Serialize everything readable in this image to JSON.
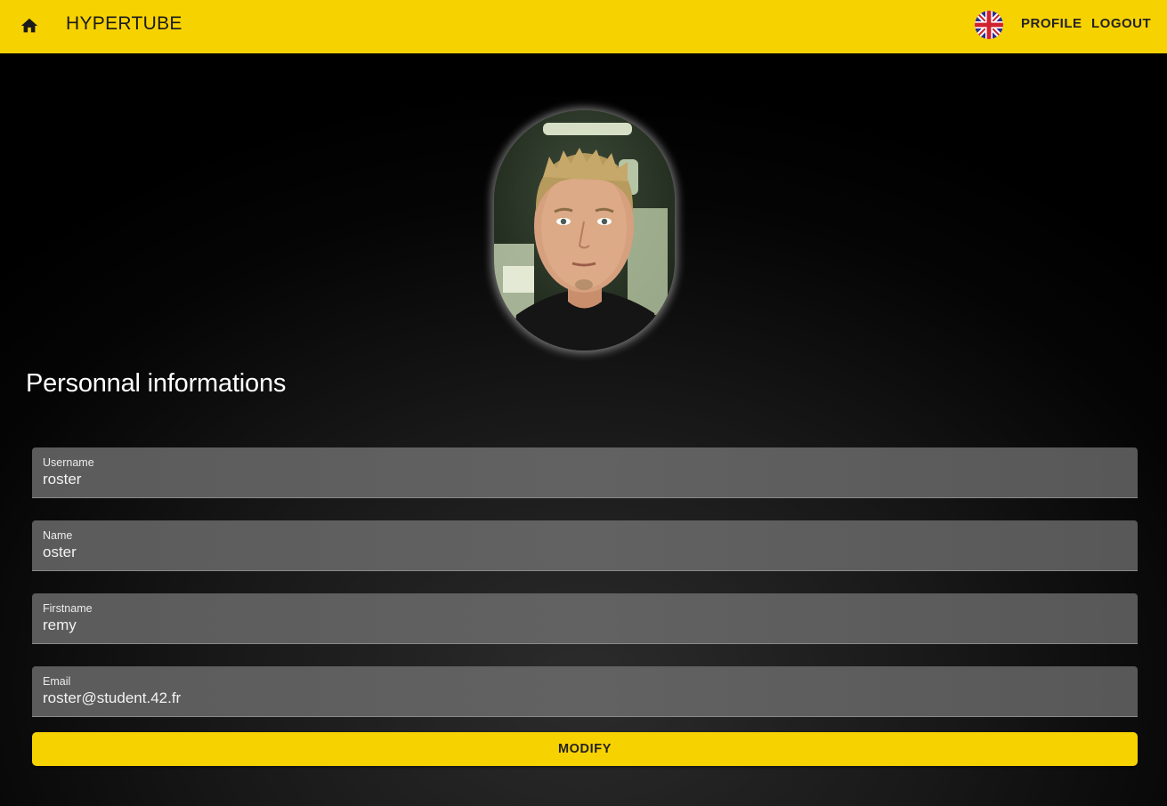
{
  "appbar": {
    "brand": "HYPERTUBE",
    "home_icon": "home-icon",
    "language_flag_icon": "uk-flag-icon",
    "nav": {
      "profile": "PROFILE",
      "logout": "LOGOUT"
    }
  },
  "profile": {
    "avatar_icon": "user-avatar-photo",
    "section_title": "Personnal informations",
    "fields": {
      "username": {
        "label": "Username",
        "value": "roster"
      },
      "name": {
        "label": "Name",
        "value": "oster"
      },
      "firstname": {
        "label": "Firstname",
        "value": "remy"
      },
      "email": {
        "label": "Email",
        "value": "roster@student.42.fr"
      }
    },
    "modify_label": "MODIFY"
  },
  "colors": {
    "accent": "#f7d201",
    "field_bg": "#5e5e5e",
    "text_light": "#ffffff"
  }
}
